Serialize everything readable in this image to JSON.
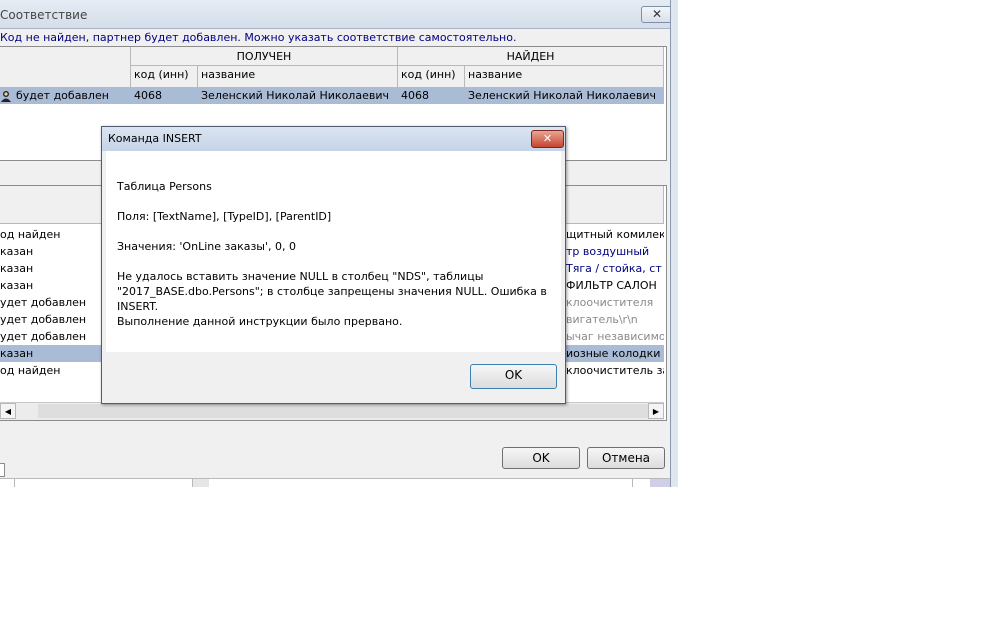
{
  "window": {
    "title": "Соответствие",
    "close_symbol": "✕",
    "notice": "Код не найден, партнер будет добавлен. Можно указать соответствие самостоятельно."
  },
  "top_grid": {
    "group_received": "ПОЛУЧЕН",
    "group_found": "НАЙДЕН",
    "col_code": "код (инн)",
    "col_name": "название",
    "row": {
      "status": "будет добавлен",
      "received_code": "4068",
      "received_name": "Зеленский Николай Николаевич",
      "found_code": "4068",
      "found_name": "Зеленский Николай Николаевич"
    }
  },
  "lower_grid": {
    "rows": [
      {
        "left": "од найден",
        "right": "щитный комилект",
        "style": "normal"
      },
      {
        "left": "казан",
        "right": "тр воздушный",
        "style": "navy"
      },
      {
        "left": "казан",
        "right": "Тяга / стойка, ст",
        "style": "navy"
      },
      {
        "left": "казан",
        "right": "ФИЛЬТР САЛОН",
        "style": "normal"
      },
      {
        "left": "удет добавлен",
        "right": "клоочистителя",
        "style": "gray"
      },
      {
        "left": "удет добавлен",
        "right": "вигатель\\r\\n",
        "style": "gray"
      },
      {
        "left": "удет добавлен",
        "right": "ычаг независимой",
        "style": "gray"
      },
      {
        "left": "казан",
        "right": "иозные колодки",
        "style": "selected"
      },
      {
        "left": "од найден",
        "right": "клоочиститель за",
        "style": "normal"
      }
    ],
    "scroll_left": "◀",
    "scroll_right": "▶"
  },
  "buttons": {
    "ok": "OK",
    "cancel": "Отмена"
  },
  "dialog": {
    "title": "Команда INSERT",
    "close_symbol": "✕",
    "lines": {
      "table": "Таблица Persons",
      "fields": "Поля: [TextName], [TypeID], [ParentID]",
      "values": "Значения: 'OnLine заказы', 0, 0",
      "error1": "Не удалось вставить значение NULL в столбец \"NDS\", таблицы",
      "error2": "\"2017_BASE.dbo.Persons\"; в столбце запрещены значения NULL. Ошибка в",
      "error3": "INSERT.",
      "error4": "Выполнение данной инструкции было прервано."
    },
    "ok": "OK"
  },
  "colors": {
    "selection": "#aabbd6",
    "notice": "#000080",
    "dialog_close": "#c7442f"
  }
}
